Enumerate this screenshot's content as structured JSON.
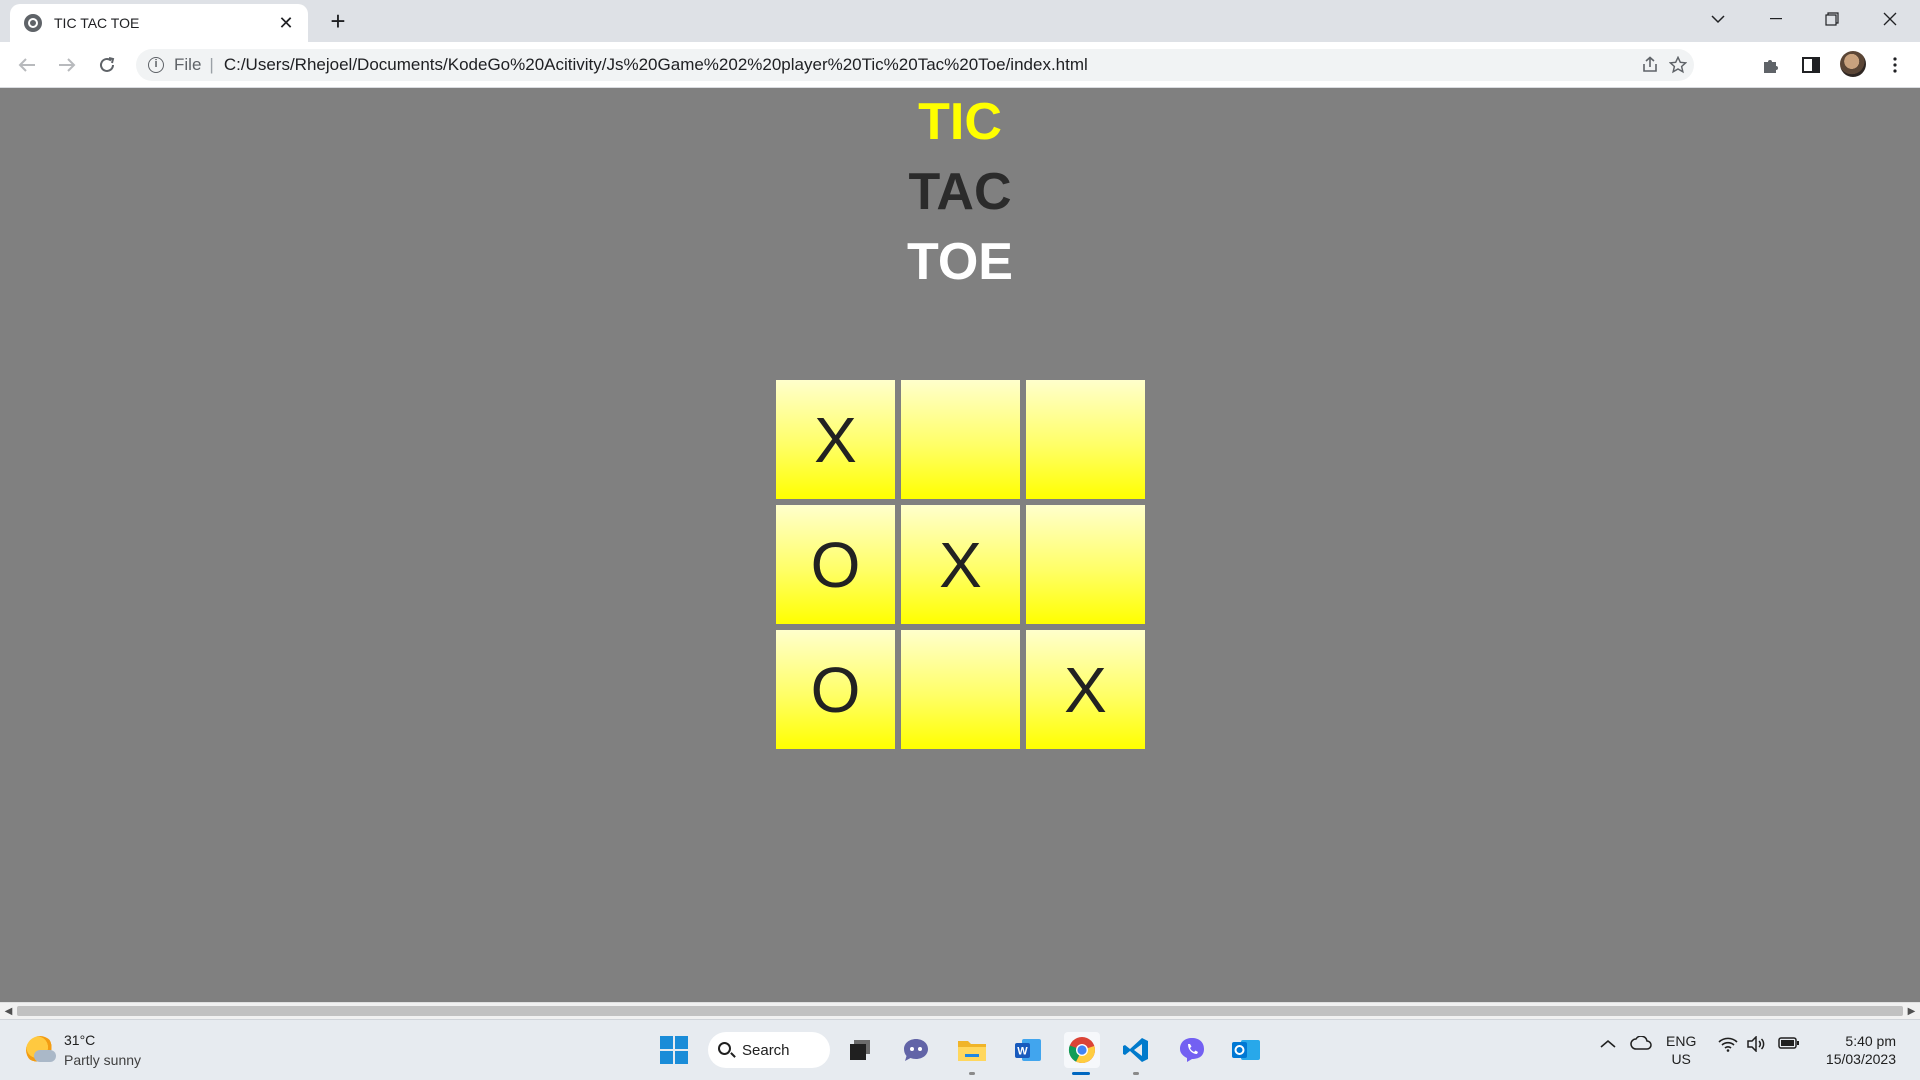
{
  "browser": {
    "tab_title": "TIC TAC TOE",
    "tab_close": "✕",
    "new_tab": "+",
    "scheme_label": "File",
    "separator": "|",
    "url": "C:/Users/Rhejoel/Documents/KodeGo%20Acitivity/Js%20Game%202%20player%20Tic%20Tac%20Toe/index.html"
  },
  "page": {
    "heading_tic": "TIC",
    "heading_tac": "TAC",
    "heading_toe": "TOE",
    "colors": {
      "background": "#808080",
      "tic": "#ffff00",
      "tac": "#2b2b2b",
      "toe": "#ffffff",
      "cell_top": "#ffffcc",
      "cell_bottom": "#ffff00"
    },
    "board": [
      [
        "X",
        "",
        ""
      ],
      [
        "O",
        "X",
        ""
      ],
      [
        "O",
        "",
        "X"
      ]
    ]
  },
  "taskbar": {
    "weather_temp": "31°C",
    "weather_desc": "Partly sunny",
    "search_label": "Search",
    "lang_top": "ENG",
    "lang_bottom": "US",
    "time": "5:40 pm",
    "date": "15/03/2023"
  }
}
